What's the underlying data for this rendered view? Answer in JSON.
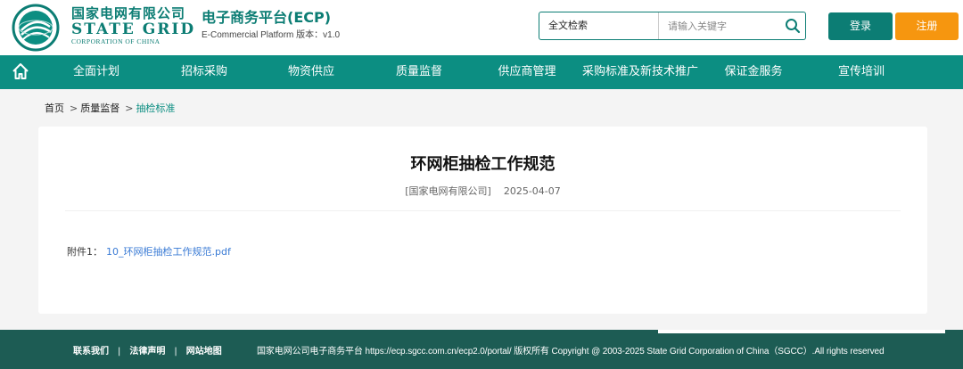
{
  "header": {
    "brand_cn": "国家电网有限公司",
    "brand_en": "STATE GRID",
    "brand_sub": "CORPORATION OF CHINA",
    "platform_title": "电子商务平台(ECP)",
    "platform_sub": "E-Commercial Platform 版本：v1.0",
    "search_scope": "全文检索",
    "search_placeholder": "请输入关键字",
    "login_label": "登录",
    "register_label": "注册"
  },
  "nav": {
    "items": [
      {
        "label": "全面计划"
      },
      {
        "label": "招标采购"
      },
      {
        "label": "物资供应"
      },
      {
        "label": "质量监督"
      },
      {
        "label": "供应商管理"
      },
      {
        "label": "采购标准及新技术推广"
      },
      {
        "label": "保证金服务"
      },
      {
        "label": "宣传培训"
      }
    ]
  },
  "breadcrumb": {
    "home": "首页",
    "sep1": ">",
    "level1": "质量监督",
    "sep2": ">",
    "current": "抽检标准"
  },
  "article": {
    "title": "环网柜抽检工作规范",
    "source": "[国家电网有限公司]",
    "date": "2025-04-07",
    "attachment_label": "附件1：",
    "attachment_file": "10_环网柜抽检工作规范.pdf"
  },
  "footer": {
    "link_contact": "联系我们",
    "link_legal": "法律声明",
    "link_sitemap": "网站地图",
    "bar": "|",
    "copyright": "国家电网公司电子商务平台 https://ecp.sgcc.com.cn/ecp2.0/portal/ 版权所有 Copyright @ 2003-2025 State Grid Corporation of China（SGCC）.All rights reserved"
  },
  "colors": {
    "brand_teal": "#0c7d74",
    "nav_bg": "#0c8e82",
    "register_orange": "#f6960f",
    "footer_bg": "#1d5c54",
    "link_blue": "#3a7bd5"
  },
  "icons": {
    "logo": "state-grid-emblem-icon",
    "search": "search-icon",
    "home": "home-icon"
  }
}
